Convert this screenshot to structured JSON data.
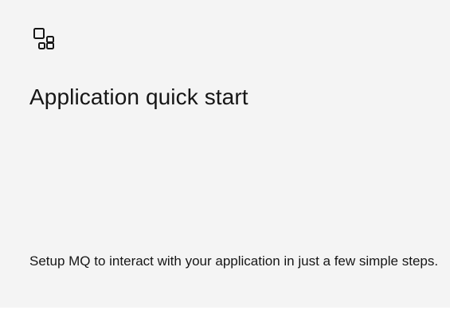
{
  "tile": {
    "icon": "application-icon",
    "title": "Application quick start",
    "description": "Setup MQ to interact with your application in just a few simple steps."
  }
}
